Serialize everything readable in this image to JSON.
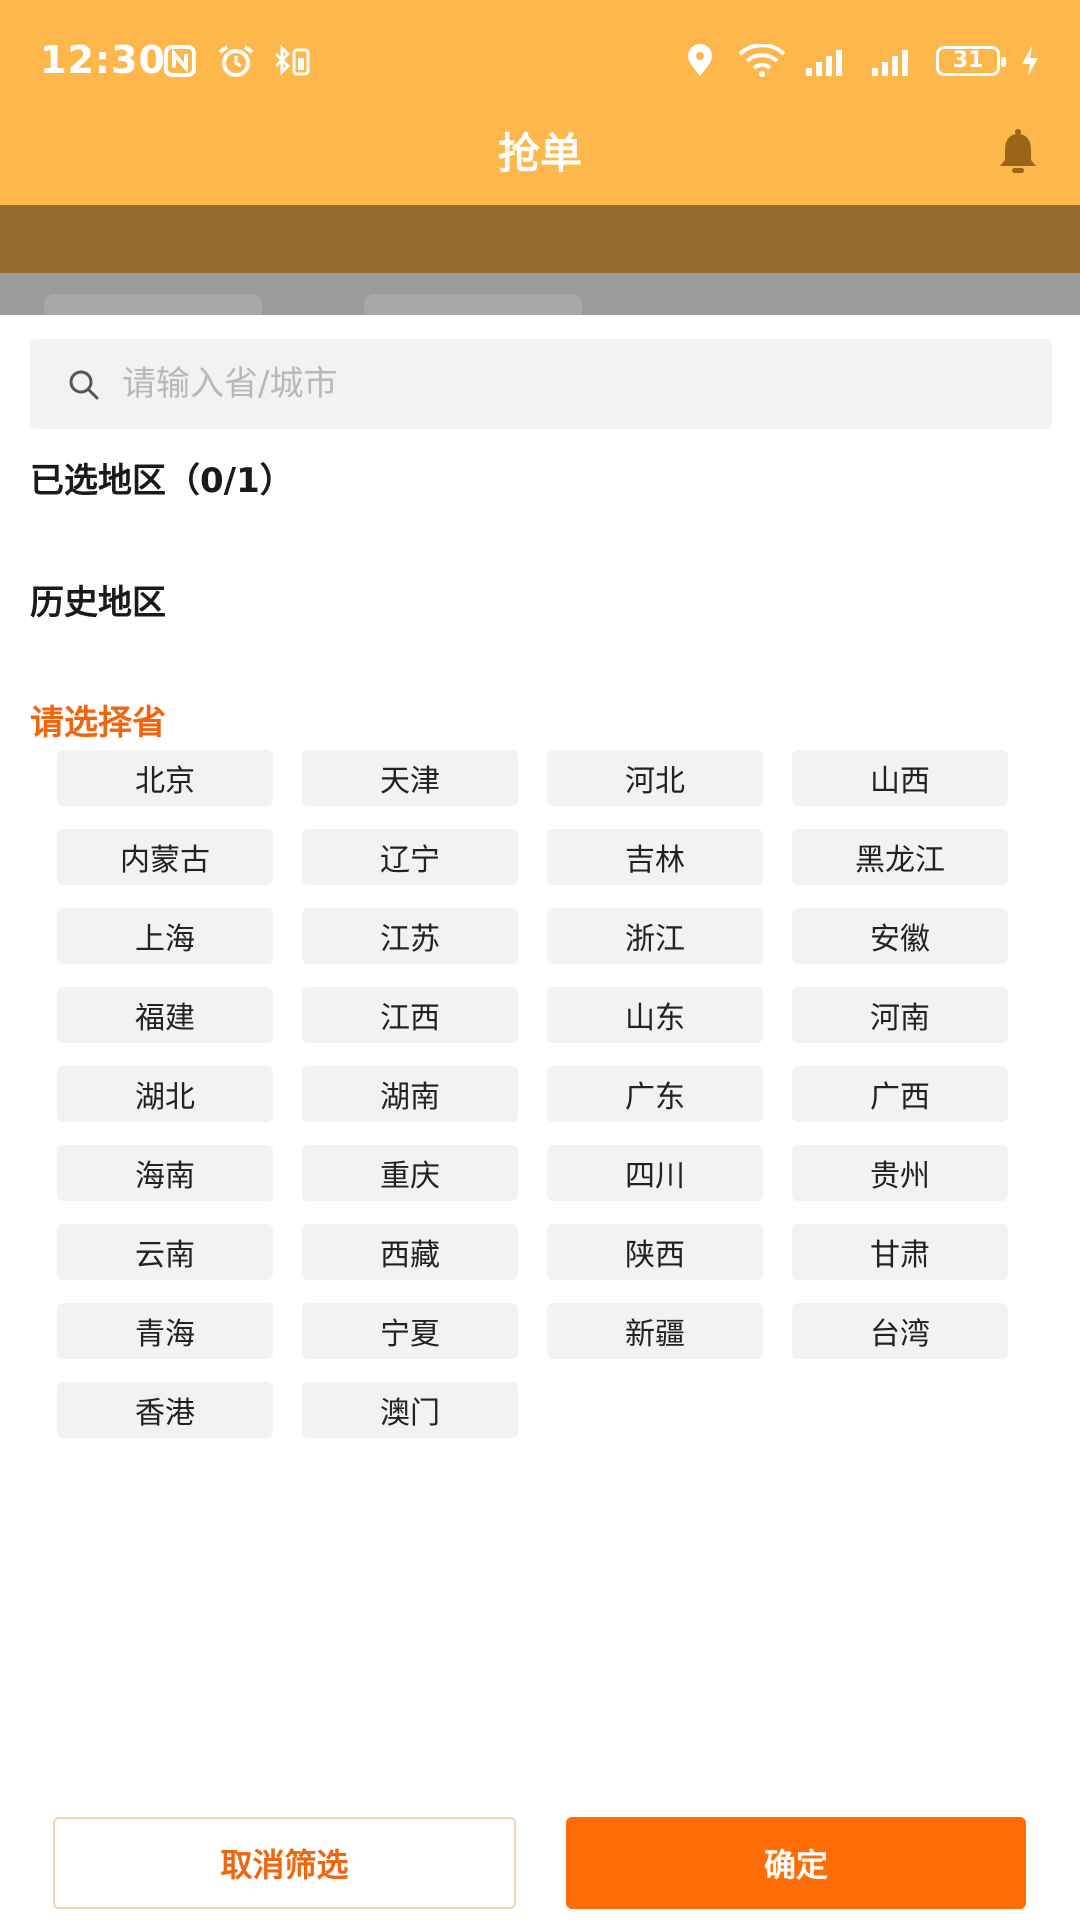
{
  "status_bar": {
    "time": "12:30",
    "battery": "31"
  },
  "header": {
    "title": "抢单"
  },
  "search": {
    "placeholder": "请输入省/城市",
    "value": ""
  },
  "sections": {
    "selected": "已选地区（0/1）",
    "history": "历史地区",
    "choose_province": "请选择省"
  },
  "provinces": [
    "北京",
    "天津",
    "河北",
    "山西",
    "内蒙古",
    "辽宁",
    "吉林",
    "黑龙江",
    "上海",
    "江苏",
    "浙江",
    "安徽",
    "福建",
    "江西",
    "山东",
    "河南",
    "湖北",
    "湖南",
    "广东",
    "广西",
    "海南",
    "重庆",
    "四川",
    "贵州",
    "云南",
    "西藏",
    "陕西",
    "甘肃",
    "青海",
    "宁夏",
    "新疆",
    "台湾",
    "香港",
    "澳门"
  ],
  "buttons": {
    "cancel": "取消筛选",
    "confirm": "确定"
  },
  "colors": {
    "header": "#FDB74B",
    "accent": "#FF6E06",
    "accent_text": "#F0650E"
  }
}
